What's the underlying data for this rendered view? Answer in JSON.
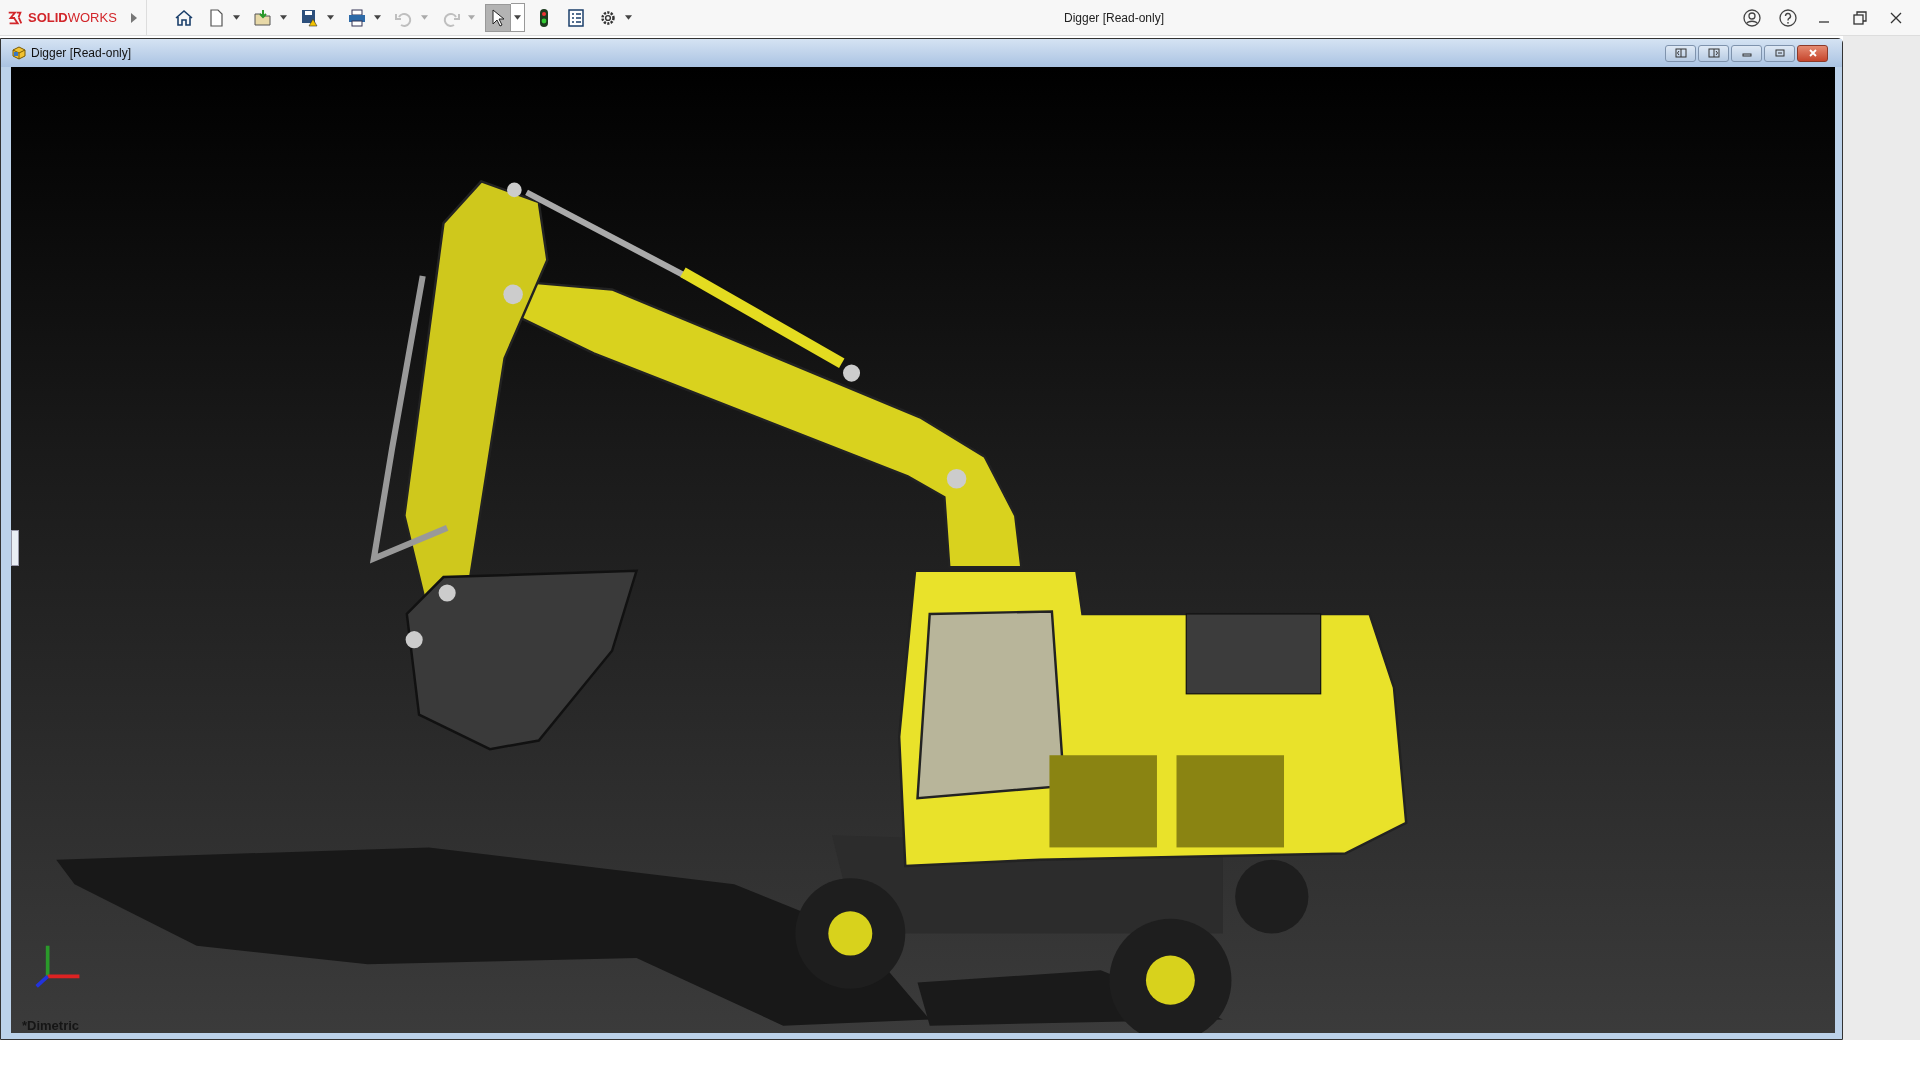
{
  "app": {
    "logo": "**SOLID**WORKS"
  },
  "toolbar": [
    {
      "kind": "home",
      "dropdown": false,
      "disabled": false,
      "selected": false
    },
    {
      "kind": "new",
      "dropdown": true,
      "disabled": false,
      "selected": false
    },
    {
      "kind": "open",
      "dropdown": true,
      "disabled": false,
      "selected": false
    },
    {
      "kind": "save",
      "dropdown": true,
      "disabled": false,
      "selected": false
    },
    {
      "kind": "print",
      "dropdown": true,
      "disabled": false,
      "selected": false
    },
    {
      "kind": "undo",
      "dropdown": true,
      "disabled": true,
      "selected": false
    },
    {
      "kind": "redo",
      "dropdown": true,
      "disabled": true,
      "selected": false
    },
    {
      "kind": "select",
      "dropdown": true,
      "disabled": false,
      "selected": true
    },
    {
      "kind": "rebuild",
      "dropdown": false,
      "disabled": false,
      "selected": false
    },
    {
      "kind": "properties",
      "dropdown": false,
      "disabled": false,
      "selected": false
    },
    {
      "kind": "options",
      "dropdown": true,
      "disabled": false,
      "selected": false
    }
  ],
  "window": {
    "title": "Digger [Read-only]"
  },
  "document": {
    "title": "Digger [Read-only]",
    "view_label": "*Dimetric"
  }
}
